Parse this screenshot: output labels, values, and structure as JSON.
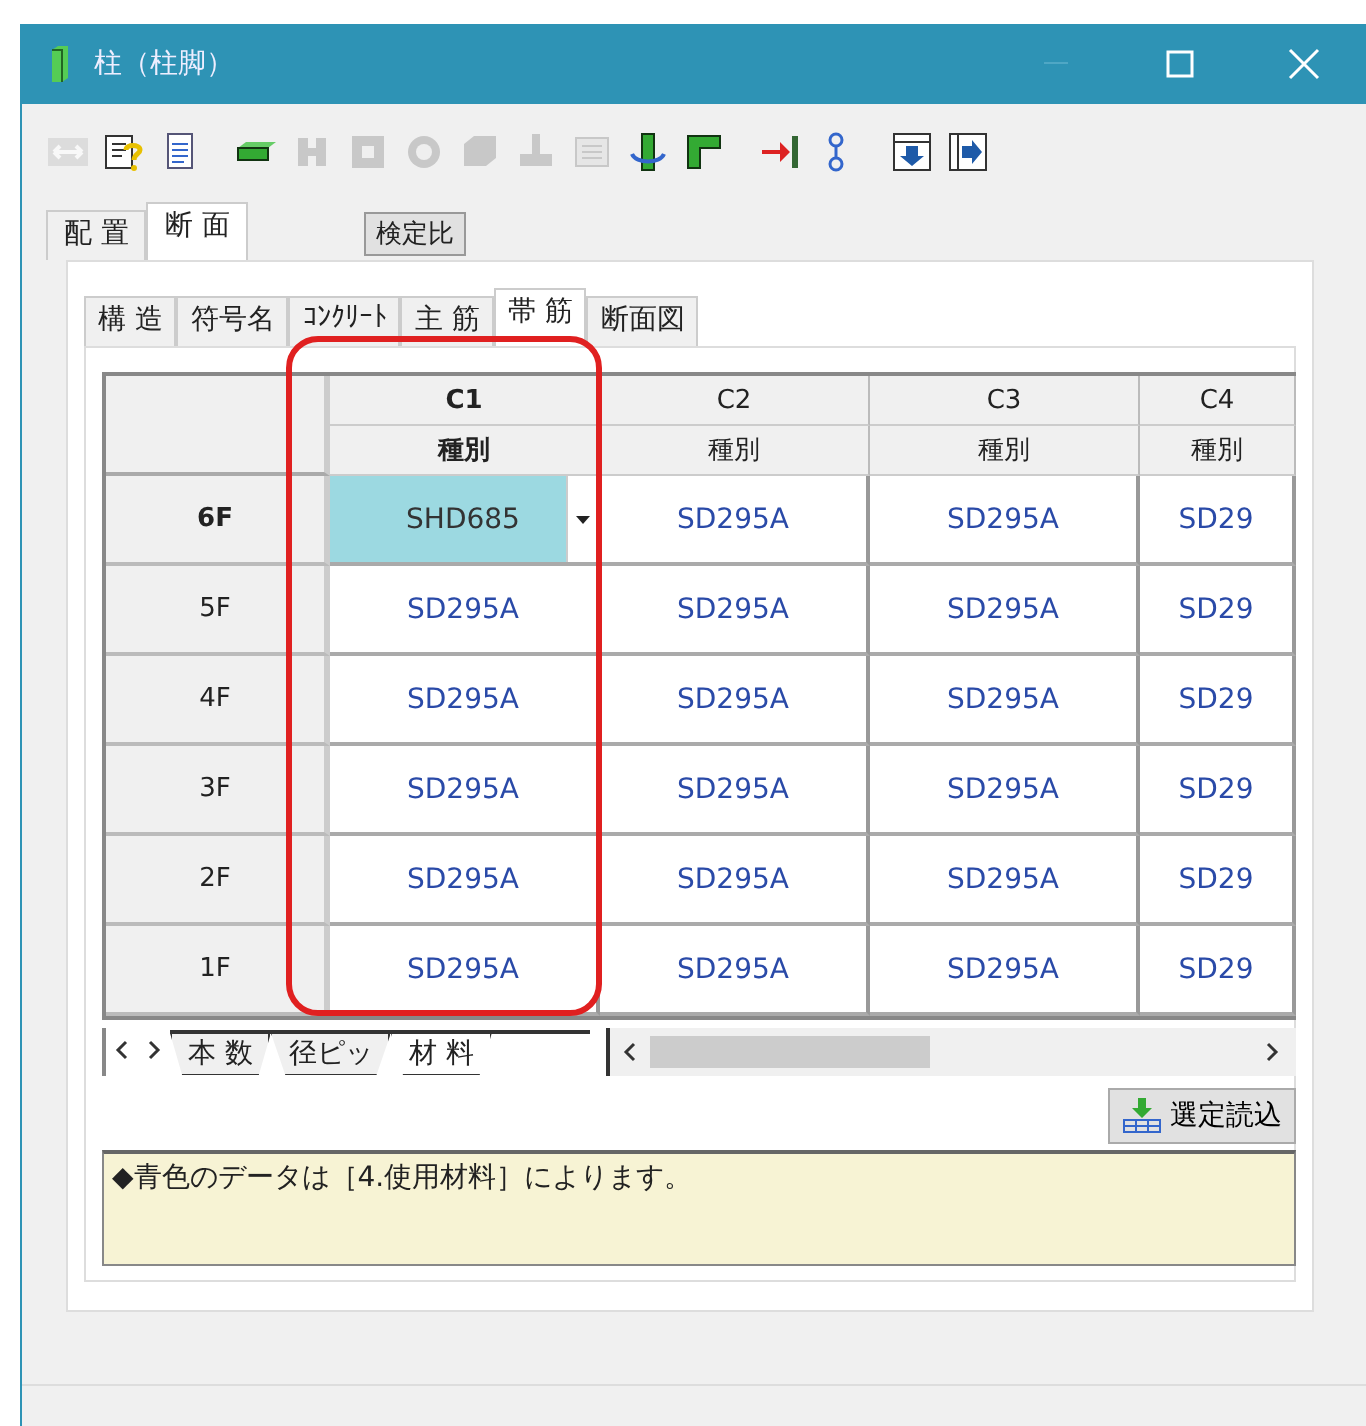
{
  "window": {
    "title": "柱（柱脚）"
  },
  "toolbar": [
    {
      "kind": "arrows",
      "disabled": true
    },
    {
      "kind": "help",
      "disabled": false
    },
    {
      "kind": "page",
      "disabled": false
    },
    {
      "kind": "beam",
      "disabled": false
    },
    {
      "kind": "hbeam",
      "disabled": true
    },
    {
      "kind": "box",
      "disabled": true
    },
    {
      "kind": "ring",
      "disabled": true
    },
    {
      "kind": "cube",
      "disabled": true
    },
    {
      "kind": "base",
      "disabled": true
    },
    {
      "kind": "panel",
      "disabled": true
    },
    {
      "kind": "rotate",
      "disabled": false
    },
    {
      "kind": "corner",
      "disabled": false
    },
    {
      "kind": "stop",
      "disabled": false
    },
    {
      "kind": "link",
      "disabled": false
    },
    {
      "kind": "down",
      "disabled": false
    },
    {
      "kind": "right",
      "disabled": false
    }
  ],
  "tabs": [
    {
      "label": "配 置",
      "selected": false
    },
    {
      "label": "断 面",
      "selected": true
    }
  ],
  "check_button": "検定比",
  "subtabs": [
    {
      "label": "構 造",
      "selected": false
    },
    {
      "label": "符号名",
      "selected": false
    },
    {
      "label": "ｺﾝｸﾘｰﾄ",
      "selected": false
    },
    {
      "label": "主 筋",
      "selected": false
    },
    {
      "label": "帯 筋",
      "selected": true
    },
    {
      "label": "断面図",
      "selected": false
    }
  ],
  "table": {
    "columns": [
      {
        "name": "C1",
        "field": "種別",
        "selected": true
      },
      {
        "name": "C2",
        "field": "種別",
        "selected": false
      },
      {
        "name": "C3",
        "field": "種別",
        "selected": false
      },
      {
        "name": "C4",
        "field": "種別",
        "selected": false
      }
    ],
    "rows": [
      {
        "label": "6F",
        "selected": true,
        "cells": [
          {
            "text": "SHD685",
            "selected": true,
            "inherited": false
          },
          {
            "text": "SD295A",
            "selected": false,
            "inherited": true
          },
          {
            "text": "SD295A",
            "selected": false,
            "inherited": true
          },
          {
            "text": "SD29",
            "selected": false,
            "inherited": true
          }
        ]
      },
      {
        "label": "5F",
        "selected": false,
        "cells": [
          {
            "text": "SD295A",
            "selected": false,
            "inherited": true
          },
          {
            "text": "SD295A",
            "selected": false,
            "inherited": true
          },
          {
            "text": "SD295A",
            "selected": false,
            "inherited": true
          },
          {
            "text": "SD29",
            "selected": false,
            "inherited": true
          }
        ]
      },
      {
        "label": "4F",
        "selected": false,
        "cells": [
          {
            "text": "SD295A",
            "selected": false,
            "inherited": true
          },
          {
            "text": "SD295A",
            "selected": false,
            "inherited": true
          },
          {
            "text": "SD295A",
            "selected": false,
            "inherited": true
          },
          {
            "text": "SD29",
            "selected": false,
            "inherited": true
          }
        ]
      },
      {
        "label": "3F",
        "selected": false,
        "cells": [
          {
            "text": "SD295A",
            "selected": false,
            "inherited": true
          },
          {
            "text": "SD295A",
            "selected": false,
            "inherited": true
          },
          {
            "text": "SD295A",
            "selected": false,
            "inherited": true
          },
          {
            "text": "SD29",
            "selected": false,
            "inherited": true
          }
        ]
      },
      {
        "label": "2F",
        "selected": false,
        "cells": [
          {
            "text": "SD295A",
            "selected": false,
            "inherited": true
          },
          {
            "text": "SD295A",
            "selected": false,
            "inherited": true
          },
          {
            "text": "SD295A",
            "selected": false,
            "inherited": true
          },
          {
            "text": "SD29",
            "selected": false,
            "inherited": true
          }
        ]
      },
      {
        "label": "1F",
        "selected": false,
        "cells": [
          {
            "text": "SD295A",
            "selected": false,
            "inherited": true
          },
          {
            "text": "SD295A",
            "selected": false,
            "inherited": true
          },
          {
            "text": "SD295A",
            "selected": false,
            "inherited": true
          },
          {
            "text": "SD29",
            "selected": false,
            "inherited": true
          }
        ]
      }
    ]
  },
  "sheet_tabs": [
    {
      "label": "本 数",
      "selected": false
    },
    {
      "label": "径ピッ",
      "selected": false
    },
    {
      "label": "材 料",
      "selected": true
    }
  ],
  "load_button": "選定読込",
  "note": "◆青色のデータは［4.使用材料］によります。"
}
